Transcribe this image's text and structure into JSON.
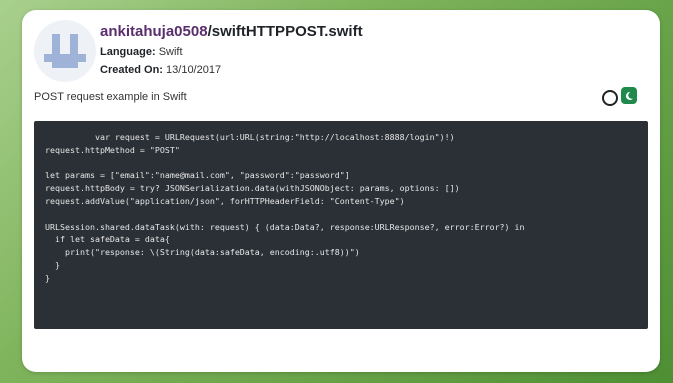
{
  "header": {
    "username": "ankitahuja0508",
    "separator": "/",
    "filename": "swiftHTTPPOST.swift"
  },
  "meta": {
    "language_label": "Language:",
    "language_value": "Swift",
    "created_label": "Created On:",
    "created_value": "13/10/2017"
  },
  "description": "POST request example in Swift",
  "theme_toggle": {
    "light_icon": "sun-icon",
    "dark_icon": "moon-icon",
    "dark_color": "#1f8a4c"
  },
  "code": "          var request = URLRequest(url:URL(string:\"http://localhost:8888/login\")!)\nrequest.httpMethod = \"POST\"\n\nlet params = [\"email\":\"name@mail.com\", \"password\":\"password\"]\nrequest.httpBody = try? JSONSerialization.data(withJSONObject: params, options: [])\nrequest.addValue(\"application/json\", forHTTPHeaderField: \"Content-Type\")\n\nURLSession.shared.dataTask(with: request) { (data:Data?, response:URLResponse?, error:Error?) in\n  if let safeData = data{\n    print(\"response: \\(String(data:safeData, encoding:.utf8))\")\n  }\n}"
}
